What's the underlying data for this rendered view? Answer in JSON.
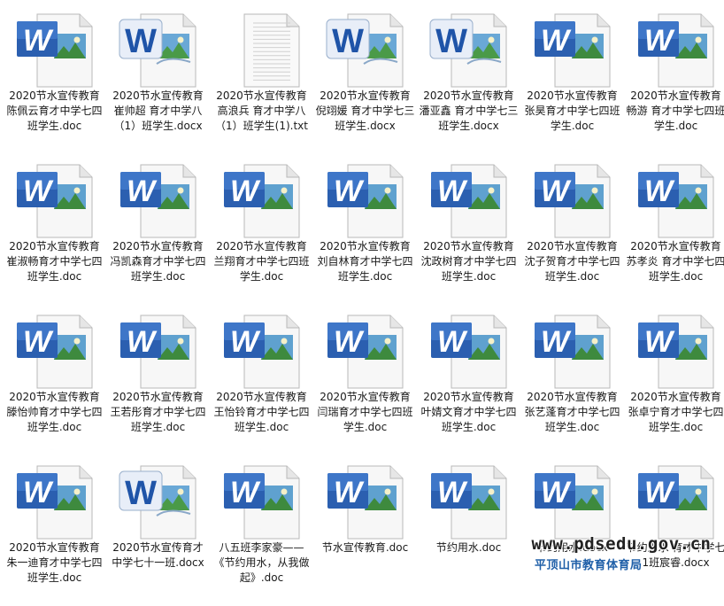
{
  "files": [
    {
      "name": "2020节水宣传教育 陈佩云育才中学七四班学生.doc",
      "type": "word"
    },
    {
      "name": "2020节水宣传教育 崔帅超 育才中学八（1）班学生.docx",
      "type": "word-new"
    },
    {
      "name": "2020节水宣传教育 高浪兵 育才中学八（1）班学生(1).txt",
      "type": "txt"
    },
    {
      "name": "2020节水宣传教育 倪翊媛 育才中学七三班学生.docx",
      "type": "word-new"
    },
    {
      "name": "2020节水宣传教育 潘亚鑫 育才中学七三班学生.docx",
      "type": "word-new"
    },
    {
      "name": "2020节水宣传教育 张昊育才中学七四班学生.doc",
      "type": "word"
    },
    {
      "name": "2020节水宣传教育畅游 育才中学七四班学生.doc",
      "type": "word"
    },
    {
      "name": "2020节水宣传教育崔淑畅育才中学七四班学生.doc",
      "type": "word"
    },
    {
      "name": "2020节水宣传教育冯凯森育才中学七四班学生.doc",
      "type": "word"
    },
    {
      "name": "2020节水宣传教育兰翔育才中学七四班学生.doc",
      "type": "word"
    },
    {
      "name": "2020节水宣传教育刘自林育才中学七四班学生.doc",
      "type": "word"
    },
    {
      "name": "2020节水宣传教育沈政树育才中学七四班学生.doc",
      "type": "word"
    },
    {
      "name": "2020节水宣传教育沈子贺育才中学七四班学生.doc",
      "type": "word"
    },
    {
      "name": "2020节水宣传教育苏孝炎 育才中学七四班学生.doc",
      "type": "word"
    },
    {
      "name": "2020节水宣传教育滕怡帅育才中学七四班学生.doc",
      "type": "word"
    },
    {
      "name": "2020节水宣传教育王若彤育才中学七四班学生.doc",
      "type": "word"
    },
    {
      "name": "2020节水宣传教育王怡铃育才中学七四班学生.doc",
      "type": "word"
    },
    {
      "name": "2020节水宣传教育闫瑞育才中学七四班学生.doc",
      "type": "word"
    },
    {
      "name": "2020节水宣传教育叶婧文育才中学七四班学生.doc",
      "type": "word"
    },
    {
      "name": "2020节水宣传教育张艺蓬育才中学七四班学生.doc",
      "type": "word"
    },
    {
      "name": "2020节水宣传教育张卓宁育才中学七四班学生.doc",
      "type": "word"
    },
    {
      "name": "2020节水宣传教育朱一迪育才中学七四班学生.doc",
      "type": "word"
    },
    {
      "name": "2020节水宣传育才中学七十一班.docx",
      "type": "word-new"
    },
    {
      "name": "八五班李家豪——《节约用水，从我做起》.doc",
      "type": "word"
    },
    {
      "name": "节水宣传教育.doc",
      "type": "word"
    },
    {
      "name": "节约用水.doc",
      "type": "word"
    },
    {
      "name": "节约用水.docx",
      "type": "word"
    },
    {
      "name": "节约用水 育才中学七 1班宸睿.docx",
      "type": "word"
    }
  ],
  "watermark": {
    "url": "www.pdsedu.gov.cn",
    "org": "平顶山市教育体育局"
  }
}
